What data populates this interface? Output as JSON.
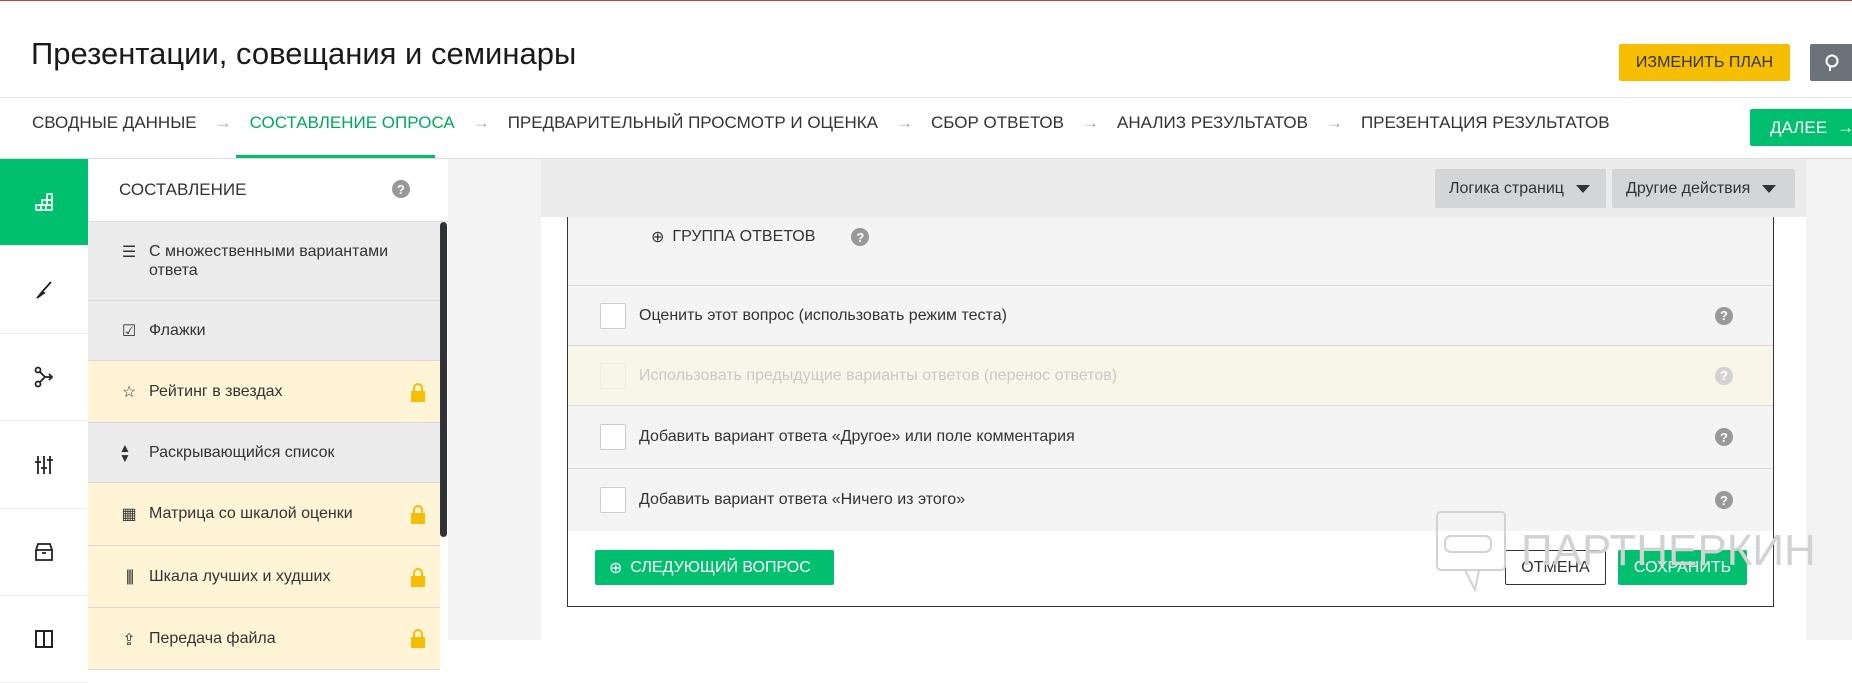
{
  "header": {
    "title": "Презентации, совещания и семинары",
    "change_plan": "ИЗМЕНИТЬ ПЛАН"
  },
  "nav": {
    "steps": [
      "СВОДНЫЕ ДАННЫЕ",
      "СОСТАВЛЕНИЕ ОПРОСА",
      "ПРЕДВАРИТЕЛЬНЫЙ ПРОСМОТР И ОЦЕНКА",
      "СБОР ОТВЕТОВ",
      "АНАЛИЗ РЕЗУЛЬТАТОВ",
      "ПРЕЗЕНТАЦИЯ РЕЗУЛЬТАТОВ"
    ],
    "active": 1,
    "next": "ДАЛЕЕ"
  },
  "sidebar": {
    "title": "СОСТАВЛЕНИЕ",
    "items": [
      {
        "label": "С множественными вариантами ответа",
        "icon": "list-icon",
        "locked": false
      },
      {
        "label": "Флажки",
        "icon": "checkbox-icon",
        "locked": false
      },
      {
        "label": "Рейтинг в звездах",
        "icon": "star-icon",
        "locked": true
      },
      {
        "label": "Раскрывающийся список",
        "icon": "dropdown-icon",
        "locked": false
      },
      {
        "label": "Матрица со шкалой оценки",
        "icon": "grid-icon",
        "locked": true
      },
      {
        "label": "Шкала лучших и худших",
        "icon": "bars-icon",
        "locked": true
      },
      {
        "label": "Передача файла",
        "icon": "upload-icon",
        "locked": true
      }
    ]
  },
  "toolbar": {
    "page_logic": "Логика страниц",
    "other_actions": "Другие действия"
  },
  "editor": {
    "group_answers": "ГРУППА ОТВЕТОВ",
    "options": [
      {
        "label": "Оценить этот вопрос (использовать режим теста)",
        "disabled": false
      },
      {
        "label": "Использовать предыдущие варианты ответов (перенос ответов)",
        "disabled": true
      },
      {
        "label": "Добавить вариант ответа «Другое» или поле комментария",
        "disabled": false
      },
      {
        "label": "Добавить вариант ответа «Ничего из этого»",
        "disabled": false
      }
    ],
    "next_question": "СЛЕДУЮЩИЙ ВОПРОС",
    "cancel": "ОТМЕНА",
    "save": "СОХРАНИТЬ"
  },
  "watermark": "ПАРТНЕРКИН",
  "colors": {
    "accent": "#00bf6f",
    "plan": "#f5be00",
    "locked_bg": "#fff4d6"
  }
}
